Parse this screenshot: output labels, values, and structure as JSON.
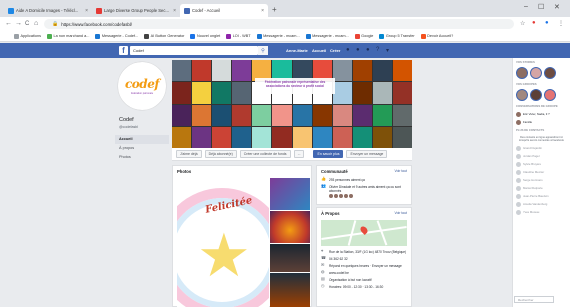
{
  "browser": {
    "tabs": [
      {
        "label": "Aide A Domicile Images - Télécl...",
        "color": "#1e88e5"
      },
      {
        "label": "Large Diverse Group People Sec...",
        "color": "#e53935"
      },
      {
        "label": "Codef - Accueil",
        "color": "#4267b2"
      }
    ],
    "new_tab": "+",
    "win_min": "–",
    "win_max": "☐",
    "win_close": "✕",
    "back": "←",
    "forward": "→",
    "reload": "C",
    "home": "⌂",
    "url": "https://www.facebook.com/codefasbl/",
    "star": "☆",
    "bookmarks": [
      {
        "label": "Applications",
        "color": "#9aa0a6"
      },
      {
        "label": "La non marchand a...",
        "color": "#4caf50"
      },
      {
        "label": "Messagerie - Codef...",
        "color": "#1976d2"
      },
      {
        "label": "AI Button Generator",
        "color": "#424242"
      },
      {
        "label": "Nouvel onglet",
        "color": "#1a73e8"
      },
      {
        "label": "LOI - WBT",
        "color": "#8e24aa"
      },
      {
        "label": "Messagerie - mcam...",
        "color": "#1976d2"
      },
      {
        "label": "Messagerie - mcam...",
        "color": "#1976d2"
      },
      {
        "label": "Google",
        "color": "#ea4335"
      },
      {
        "label": "Group 5 Transfer",
        "color": "#0288d1"
      },
      {
        "label": "Devoir Accueil?",
        "color": "#f4511e"
      }
    ]
  },
  "fb": {
    "logo": "f",
    "search_value": "Codef",
    "search_icon": "🔍",
    "nav_user": "Anne-Marie",
    "nav_home": "Accueil",
    "nav_create": "Créer",
    "page_name": "Codef",
    "page_handle": "@codefasbl",
    "logo_text": "codef",
    "logo_tag": "fédération patronale",
    "left_nav": [
      "Accueil",
      "À propos",
      "Photos"
    ],
    "cover_caption": "Fédération patronale représentative des associations du secteur à profit social",
    "actions": [
      "J'aime déjà",
      "Déjà abonné(e)",
      "Créer une collecte de fonds",
      "...",
      "En savoir plus",
      "Envoyer un message"
    ],
    "photos_title": "Photos",
    "photo_word": "Felicitée",
    "community_title": "Communauté",
    "see_all": "Voir tout",
    "community_rows": [
      "293 personnes aiment ça",
      "Olivier Dinsdale et 9 autres amis aiment ça ou sont abonnés"
    ],
    "apropos_title": "À Propos",
    "apropos_link": "Voir tout",
    "apropos_rows": [
      "Rue de la Station, 33/F (1G loc) 4870 Trooz (Belgique)",
      "04 362 62 32",
      "Répond en quelques heures · Envoyer un message",
      "www.codef.be",
      "Organisation à but non lucratif",
      "Horaires: 09:00 - 12:30 · 13:30 - 16:30"
    ]
  },
  "sidebar": {
    "stories_title": "VOS STORIES",
    "groups_title": "VOS GROUPES",
    "conv_title": "CONVERSATIONS DE GROUPE",
    "contacts_title": "PLUS DE CONTACTS",
    "contacts_on": [
      "Eric Vivier, Nadia, 3 ?",
      "Famille"
    ],
    "note": "Des contacts en ligne apparaîtront ici lorsqu'ils seront connectés à Facebook",
    "contacts_off": [
      "Grand Dujardin",
      "Jordan Pagel",
      "Sylvie Bruyère",
      "Claudine Mercier",
      "Serge Hormans",
      "Marcel Delporte",
      "Jean-Pierre Bauduin",
      "Amelia Vandenberg",
      "Yves Moreau"
    ],
    "search_placeholder": "Rechercher"
  },
  "colors": {
    "fb_blue": "#4267b2",
    "fb_bg": "#e9ebee"
  }
}
